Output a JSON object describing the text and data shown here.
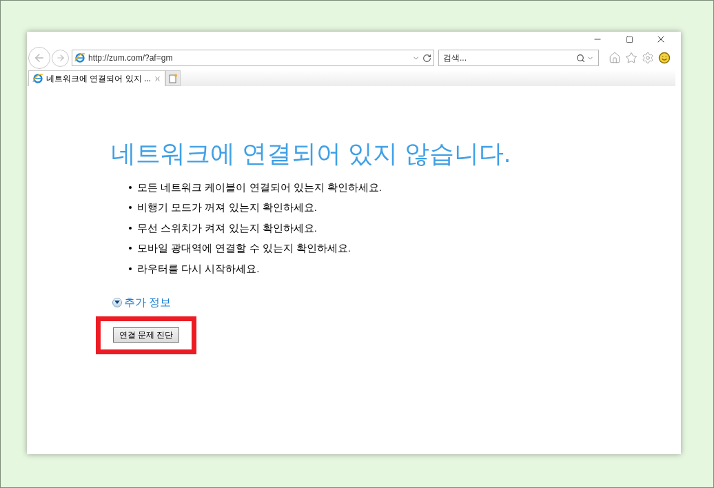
{
  "address_bar": {
    "url": "http://zum.com/?af=gm"
  },
  "search": {
    "placeholder": "검색..."
  },
  "tabs": [
    {
      "label": "네트워크에 연결되어 있지 ...",
      "selected": true
    }
  ],
  "page": {
    "heading": "네트워크에 연결되어 있지 않습니다.",
    "bullets": [
      "모든 네트워크 케이블이 연결되어 있는지 확인하세요.",
      "비행기 모드가 꺼져 있는지 확인하세요.",
      "무선 스위치가 켜져 있는지 확인하세요.",
      "모바일 광대역에 연결할 수 있는지 확인하세요.",
      "라우터를 다시 시작하세요."
    ],
    "more_info": {
      "label": "추가 정보",
      "expanded": false
    },
    "diagnose_button": {
      "label": "연결 문제 진단",
      "highlighted": true
    }
  }
}
